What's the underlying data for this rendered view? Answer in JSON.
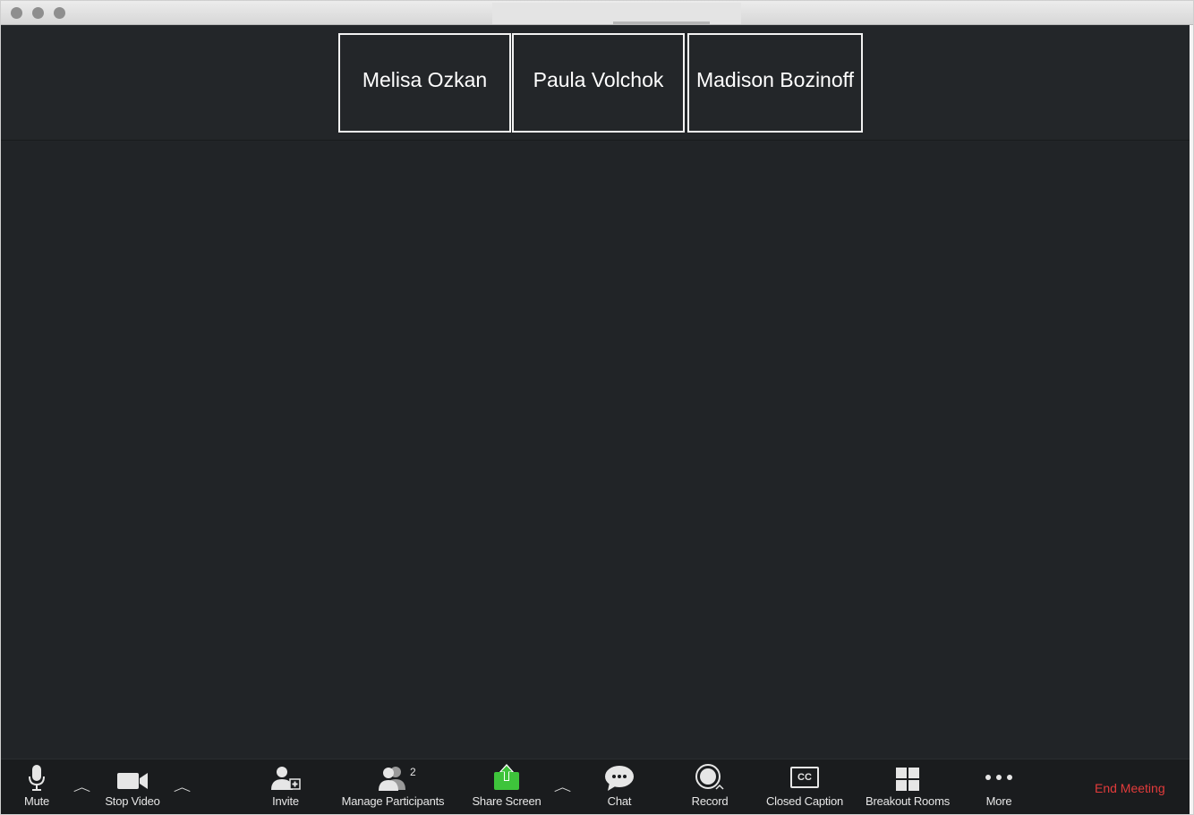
{
  "participants": [
    {
      "name": "Melisa Ozkan"
    },
    {
      "name": "Paula Volchok"
    },
    {
      "name": "Madison Bozinoff"
    }
  ],
  "toolbar": {
    "mute": {
      "label": "Mute",
      "icon": "microphone-icon"
    },
    "stop_video": {
      "label": "Stop Video",
      "icon": "video-camera-icon"
    },
    "invite": {
      "label": "Invite",
      "icon": "add-person-icon"
    },
    "manage_participants": {
      "label": "Manage Participants",
      "icon": "participants-icon",
      "count": "2"
    },
    "share_screen": {
      "label": "Share Screen",
      "icon": "share-screen-icon",
      "accent": "#3ec43b"
    },
    "chat": {
      "label": "Chat",
      "icon": "chat-bubble-icon"
    },
    "record": {
      "label": "Record",
      "icon": "record-icon"
    },
    "closed_caption": {
      "label": "Closed Caption",
      "icon": "cc-icon",
      "icon_text": "CC"
    },
    "breakout_rooms": {
      "label": "Breakout Rooms",
      "icon": "grid-icon"
    },
    "more": {
      "label": "More",
      "icon": "more-dots-icon"
    },
    "end_meeting": {
      "label": "End Meeting",
      "color": "#e23b3b"
    }
  }
}
